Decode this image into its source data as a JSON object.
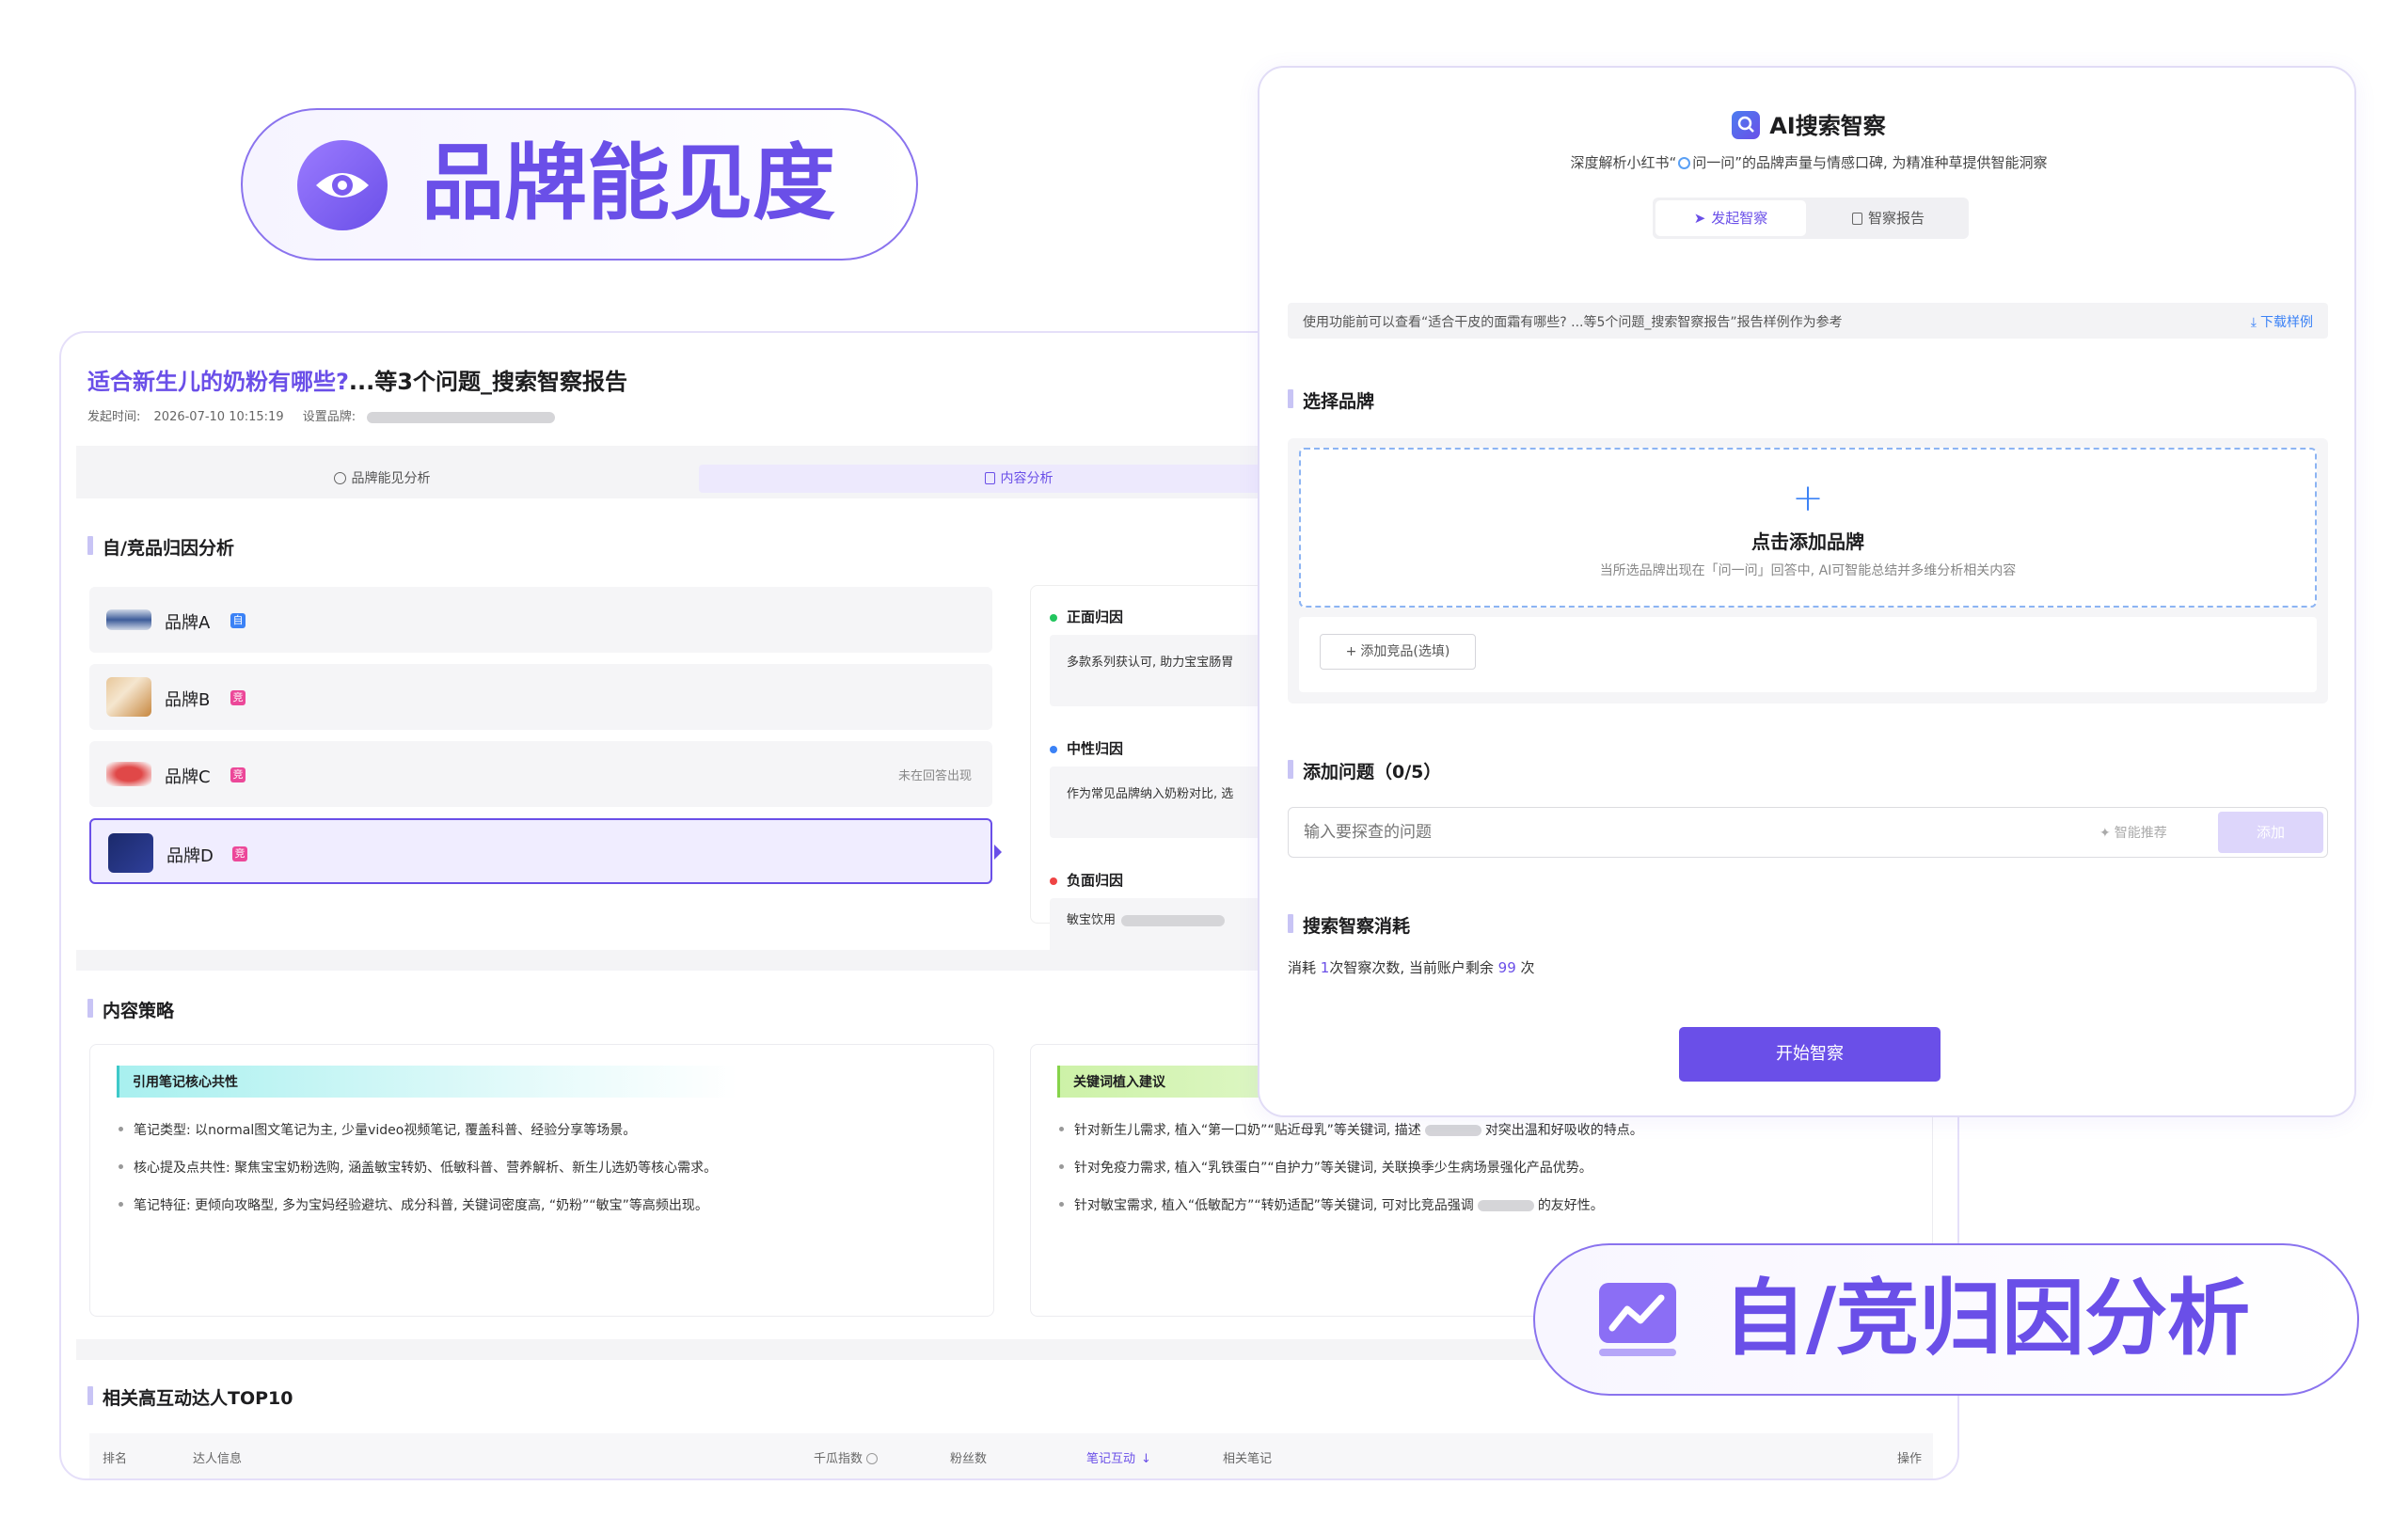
{
  "badges": {
    "visibility": {
      "label": "品牌能见度",
      "icon": "eye-icon"
    },
    "attribution": {
      "label": "自/竞归因分析",
      "icon": "trend-chart-icon"
    }
  },
  "report": {
    "title_highlight": "适合新生儿的奶粉有哪些?",
    "title_rest": "...等3个问题_搜索智察报告",
    "meta_time_label": "发起时间:",
    "meta_time": "2026-07-10 10:15:19",
    "meta_brand_label": "设置品牌:",
    "tabs": [
      {
        "label": "品牌能见分析",
        "icon": "clock-icon"
      },
      {
        "label": "内容分析",
        "icon": "document-icon"
      }
    ],
    "attribution_title": "自/竞品归因分析",
    "brands": [
      {
        "name": "品牌A",
        "tag": "自",
        "tag_color": "#3b82f6",
        "note": ""
      },
      {
        "name": "品牌B",
        "tag": "竞",
        "tag_color": "#ec4899",
        "note": ""
      },
      {
        "name": "品牌C",
        "tag": "竞",
        "tag_color": "#ec4899",
        "note": "未在回答出现"
      },
      {
        "name": "品牌D",
        "tag": "竞",
        "tag_color": "#ec4899",
        "note": ""
      }
    ],
    "reasons": [
      {
        "label": "正面归因",
        "color": "#22c55e",
        "text": "多款系列获认可, 助力宝宝肠胃"
      },
      {
        "label": "中性归因",
        "color": "#3b82f6",
        "text": "作为常见品牌纳入奶粉对比, 选"
      },
      {
        "label": "负面归因",
        "color": "#ef4444",
        "text": "敏宝饮用"
      }
    ],
    "strategy_title": "内容策略",
    "strategy_left": {
      "header": "引用笔记核心共性",
      "items": [
        "笔记类型: 以normal图文笔记为主, 少量video视频笔记, 覆盖科普、经验分享等场景。",
        "核心提及点共性: 聚焦宝宝奶粉选购, 涵盖敏宝转奶、低敏科普、营养解析、新生儿选奶等核心需求。",
        "笔记特征: 更倾向攻略型, 多为宝妈经验避坑、成分科普, 关键词密度高, “奶粉”“敏宝”等高频出现。"
      ]
    },
    "strategy_right": {
      "header": "关键词植入建议",
      "items": [
        {
          "a": "针对新生儿需求, 植入“第一口奶”“贴近母乳”等关键词, 描述",
          "b": "对突出温和好吸收的特点。"
        },
        {
          "a": "针对免疫力需求, 植入“乳铁蛋白”“自护力”等关键词, 关联换季少生病场景强化产品优势。",
          "b": ""
        },
        {
          "a": "针对敏宝需求, 植入“低敏配方”“转奶适配”等关键词, 可对比竞品强调",
          "b": "的友好性。"
        }
      ]
    },
    "kol_title": "相关高互动达人TOP10",
    "table_headers": [
      "排名",
      "达人信息",
      "千瓜指数",
      "粉丝数",
      "笔记互动",
      "相关笔记",
      "操作"
    ]
  },
  "form": {
    "title": "AI搜索智察",
    "subtitle_a": "深度解析小红书“",
    "subtitle_b": "问一问”的品牌声量与情感口碑, 为精准种草提供智能洞察",
    "tabs": [
      {
        "label": "发起智察",
        "icon": "send-icon"
      },
      {
        "label": "智察报告",
        "icon": "report-icon"
      }
    ],
    "notice": "使用功能前可以查看“适合干皮的面霜有哪些? ...等5个问题_搜索智察报告”报告样例作为参考",
    "download_label": "下载样例",
    "brand_section": "选择品牌",
    "add_brand_title": "点击添加品牌",
    "add_brand_desc": "当所选品牌出现在「问一问」回答中, AI可智能总结并多维分析相关内容",
    "add_competitor": "添加竞品(选填)",
    "question_section": "添加问题（0/5）",
    "question_placeholder": "输入要探查的问题",
    "smart_recommend": "智能推荐",
    "add_button": "添加",
    "cost_section": "搜索智察消耗",
    "cost_a": "消耗",
    "cost_num": "1",
    "cost_b": "次智察次数, 当前账户剩余",
    "remaining": "99",
    "cost_c": "次",
    "start_button": "开始智察"
  }
}
